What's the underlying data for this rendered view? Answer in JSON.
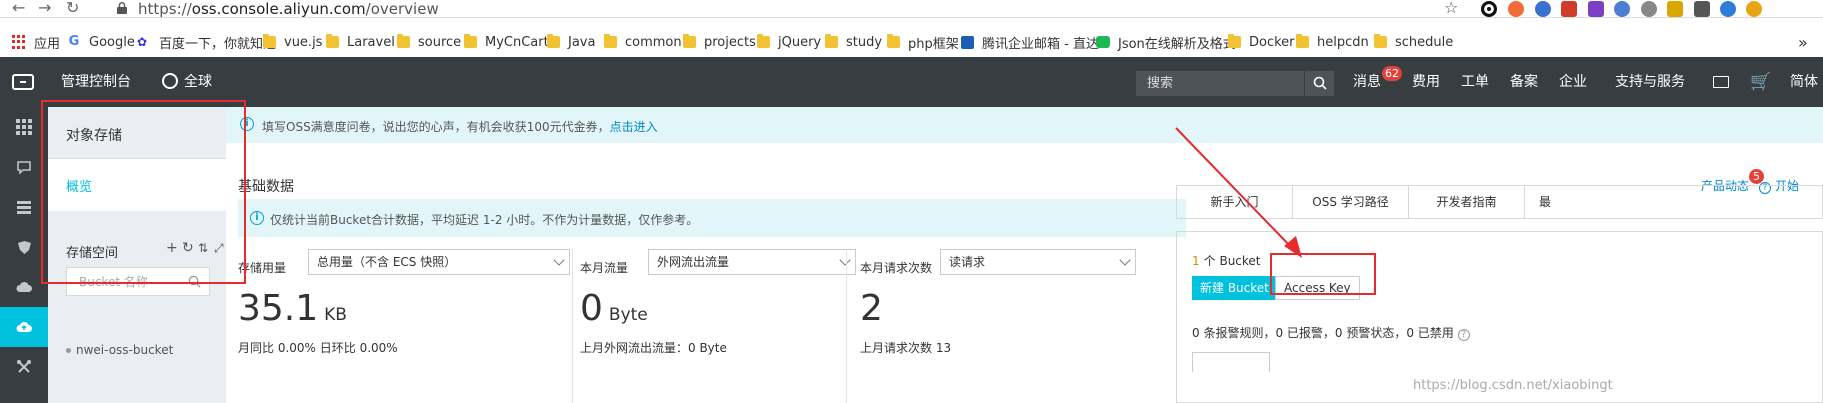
{
  "browser": {
    "url_protocol": "https://",
    "url_host": "oss.console.aliyun.com",
    "url_path": "/overview",
    "bookmarks": [
      {
        "label": "应用",
        "icon": "apps-icon"
      },
      {
        "label": "Google",
        "icon": "google-icon"
      },
      {
        "label": "百度一下，你就知道",
        "icon": "baidu-icon"
      },
      {
        "label": "vue.js",
        "icon": "folder-icon"
      },
      {
        "label": "Laravel",
        "icon": "folder-icon"
      },
      {
        "label": "source",
        "icon": "folder-icon"
      },
      {
        "label": "MyCnCart",
        "icon": "folder-icon"
      },
      {
        "label": "Java",
        "icon": "folder-icon"
      },
      {
        "label": "common",
        "icon": "folder-icon"
      },
      {
        "label": "projects",
        "icon": "folder-icon"
      },
      {
        "label": "jQuery",
        "icon": "folder-icon"
      },
      {
        "label": "study",
        "icon": "folder-icon"
      },
      {
        "label": "php框架",
        "icon": "folder-icon"
      },
      {
        "label": "腾讯企业邮箱 - 直达",
        "icon": "qq-mail-icon"
      },
      {
        "label": "Json在线解析及格式",
        "icon": "json-icon"
      },
      {
        "label": "Docker",
        "icon": "folder-icon"
      },
      {
        "label": "helpcdn",
        "icon": "folder-icon"
      },
      {
        "label": "schedule",
        "icon": "folder-icon"
      }
    ],
    "more": "»"
  },
  "topnav": {
    "console_title": "管理控制台",
    "region": "全球",
    "search_placeholder": "搜索",
    "messages": "消息",
    "messages_count": "62",
    "items": [
      "费用",
      "工单",
      "备案",
      "企业",
      "支持与服务"
    ],
    "language": "简体"
  },
  "sidebar": {
    "title": "对象存储",
    "overview": "概览",
    "bucket_heading": "存储空间",
    "bucket_search_placeholder": "Bucket 名称",
    "buckets": [
      "nwei-oss-bucket"
    ]
  },
  "main": {
    "notice": "填写OSS满意度问卷，说出您的心声，有机会收获100元代金券，",
    "notice_link": "点击进入",
    "basic_title": "基础数据",
    "product_news": "产品动态",
    "product_news_count": "5",
    "start_use": "开始",
    "stat_notice": "仅统计当前Bucket合计数据，平均延迟 1-2 小时。不作为计量数据，仅作参考。",
    "stats": [
      {
        "label": "存储用量",
        "select": "总用量（不含 ECS 快照）",
        "value": "35.1",
        "unit": "KB",
        "sub": "月同比 0.00%   日环比 0.00%"
      },
      {
        "label": "本月流量",
        "select": "外网流出流量",
        "value": "0",
        "unit": "Byte",
        "sub": "上月外网流出流量：0 Byte"
      },
      {
        "label": "本月请求次数",
        "select": "读请求",
        "value": "2",
        "unit": "",
        "sub": "上月请求次数  13"
      }
    ],
    "tabs": [
      "新手入门",
      "OSS 学习路径",
      "开发者指南",
      "最"
    ],
    "bucket_count_num": "1",
    "bucket_count_text": "个 Bucket",
    "new_bucket": "新建 Bucket",
    "access_key": "Access Key",
    "rules": "0 条报警规则，0 已报警，0 预警状态，0 已禁用"
  },
  "watermark": "https://blog.csdn.net/xiaobingt"
}
